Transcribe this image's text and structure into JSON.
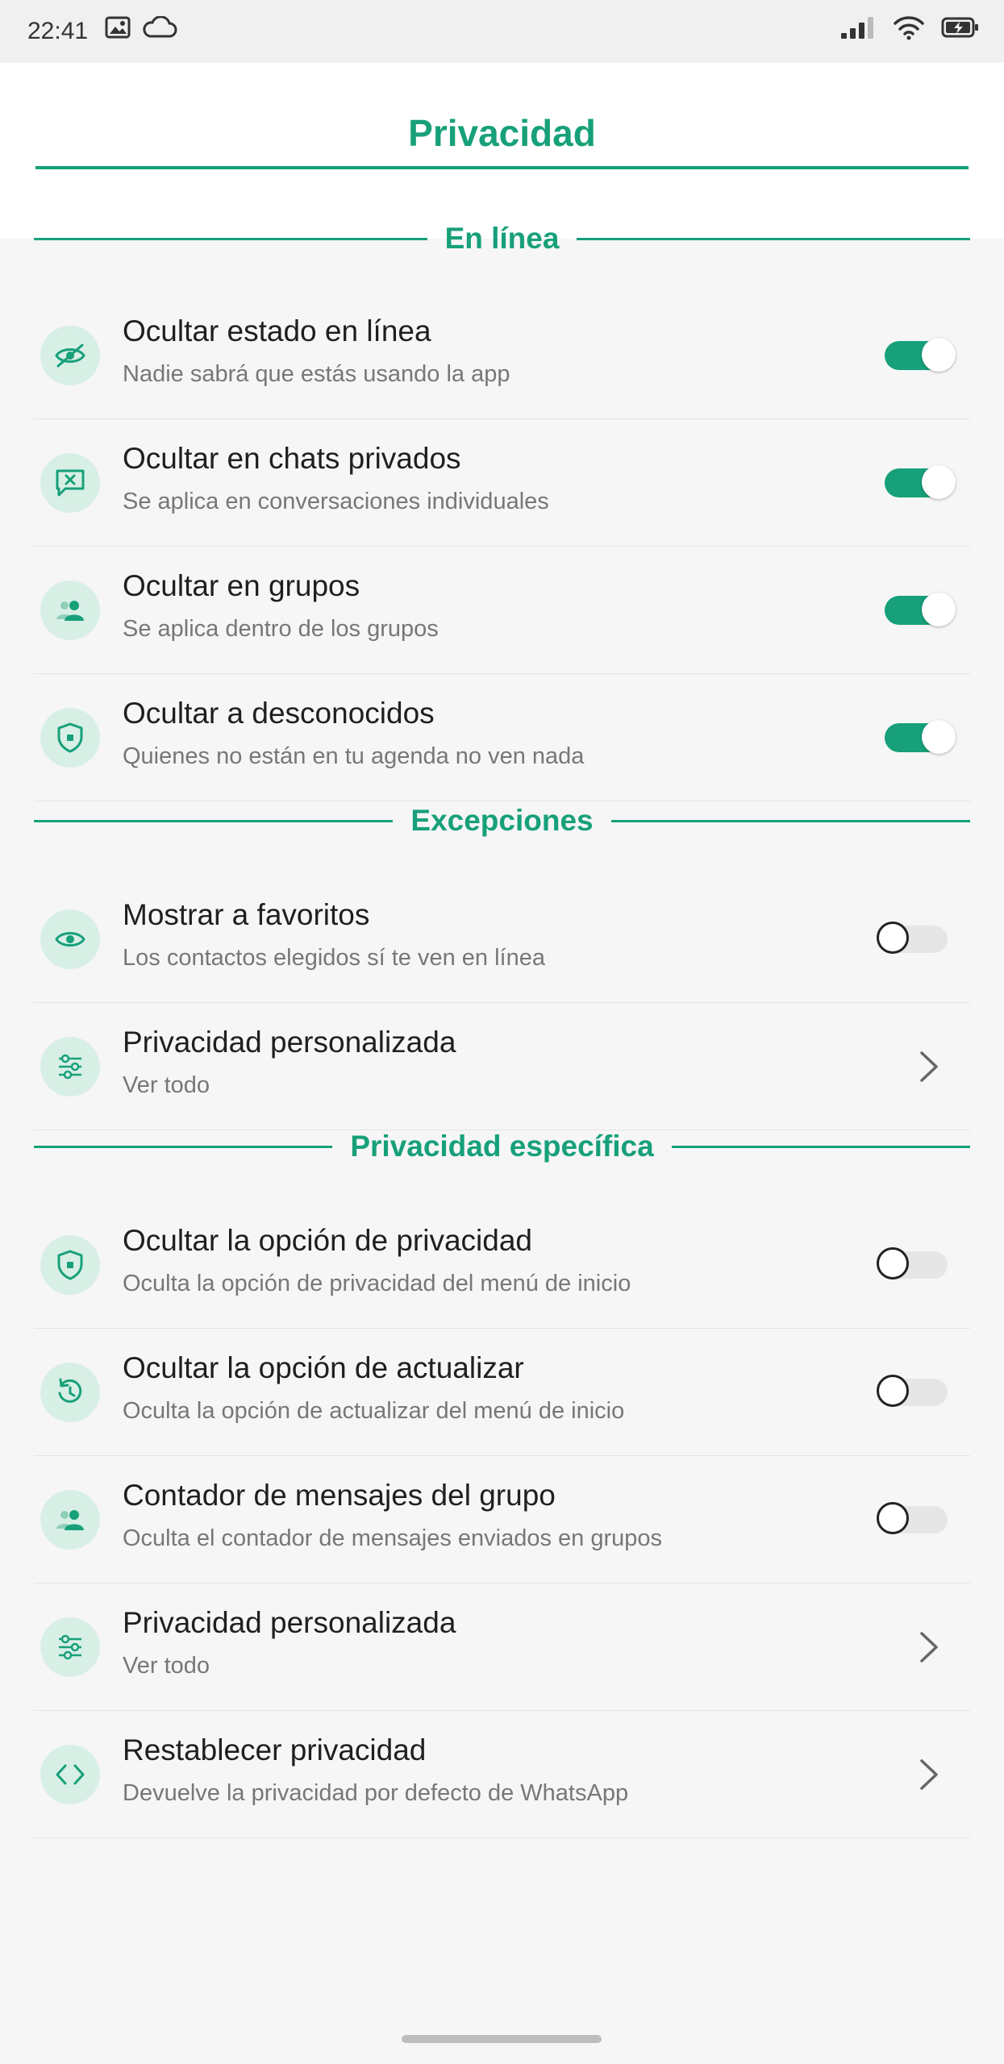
{
  "status_bar": {
    "time": "22:41",
    "left_icons": [
      "image-icon",
      "cloud-icon"
    ],
    "right_icons": [
      "signal-icon",
      "wifi-icon",
      "battery-charging-icon"
    ]
  },
  "header": {
    "title": "Privacidad"
  },
  "colors": {
    "accent": "#17a07a",
    "icon_bg": "#d8efe6"
  },
  "sections": {
    "online": {
      "label": "En línea",
      "rows": [
        {
          "title": "Ocultar estado en línea",
          "subtitle": "Nadie sabrá que estás usando la app",
          "icon": "eye-slash-icon",
          "control": "toggle",
          "on": true
        },
        {
          "title": "Ocultar en chats privados",
          "subtitle": "Se aplica en conversaciones individuales",
          "icon": "chat-x-icon",
          "control": "toggle",
          "on": true
        },
        {
          "title": "Ocultar en grupos",
          "subtitle": "Se aplica dentro de los grupos",
          "icon": "group-icon",
          "control": "toggle",
          "on": true
        },
        {
          "title": "Ocultar a desconocidos",
          "subtitle": "Quienes no están en tu agenda no ven nada",
          "icon": "shield-icon",
          "control": "toggle",
          "on": true
        }
      ]
    },
    "exceptions": {
      "label": "Excepciones",
      "rows": [
        {
          "title": "Mostrar a favoritos",
          "subtitle": "Los contactos elegidos sí te ven en línea",
          "icon": "eye-icon",
          "control": "toggle",
          "on": false
        },
        {
          "title": "Privacidad personalizada",
          "subtitle": "Ver todo",
          "icon": "sliders-icon",
          "control": "chevron"
        }
      ]
    },
    "specific": {
      "label": "Privacidad específica",
      "rows": [
        {
          "title": "Ocultar la opción de privacidad",
          "subtitle": "Oculta la opción de privacidad del menú de inicio",
          "icon": "shield-icon",
          "control": "toggle",
          "on": false
        },
        {
          "title": "Ocultar la opción de actualizar",
          "subtitle": "Oculta la opción de actualizar del menú de inicio",
          "icon": "refresh-icon",
          "control": "toggle",
          "on": false
        },
        {
          "title": "Contador de mensajes del grupo",
          "subtitle": "Oculta el contador de mensajes enviados en grupos",
          "icon": "group-icon",
          "control": "toggle",
          "on": false
        },
        {
          "title": "Privacidad personalizada",
          "subtitle": "Ver todo",
          "icon": "sliders-icon",
          "control": "chevron"
        },
        {
          "title": "Restablecer privacidad",
          "subtitle": "Devuelve la privacidad por defecto de WhatsApp",
          "icon": "code-icon",
          "control": "chevron"
        }
      ]
    }
  }
}
